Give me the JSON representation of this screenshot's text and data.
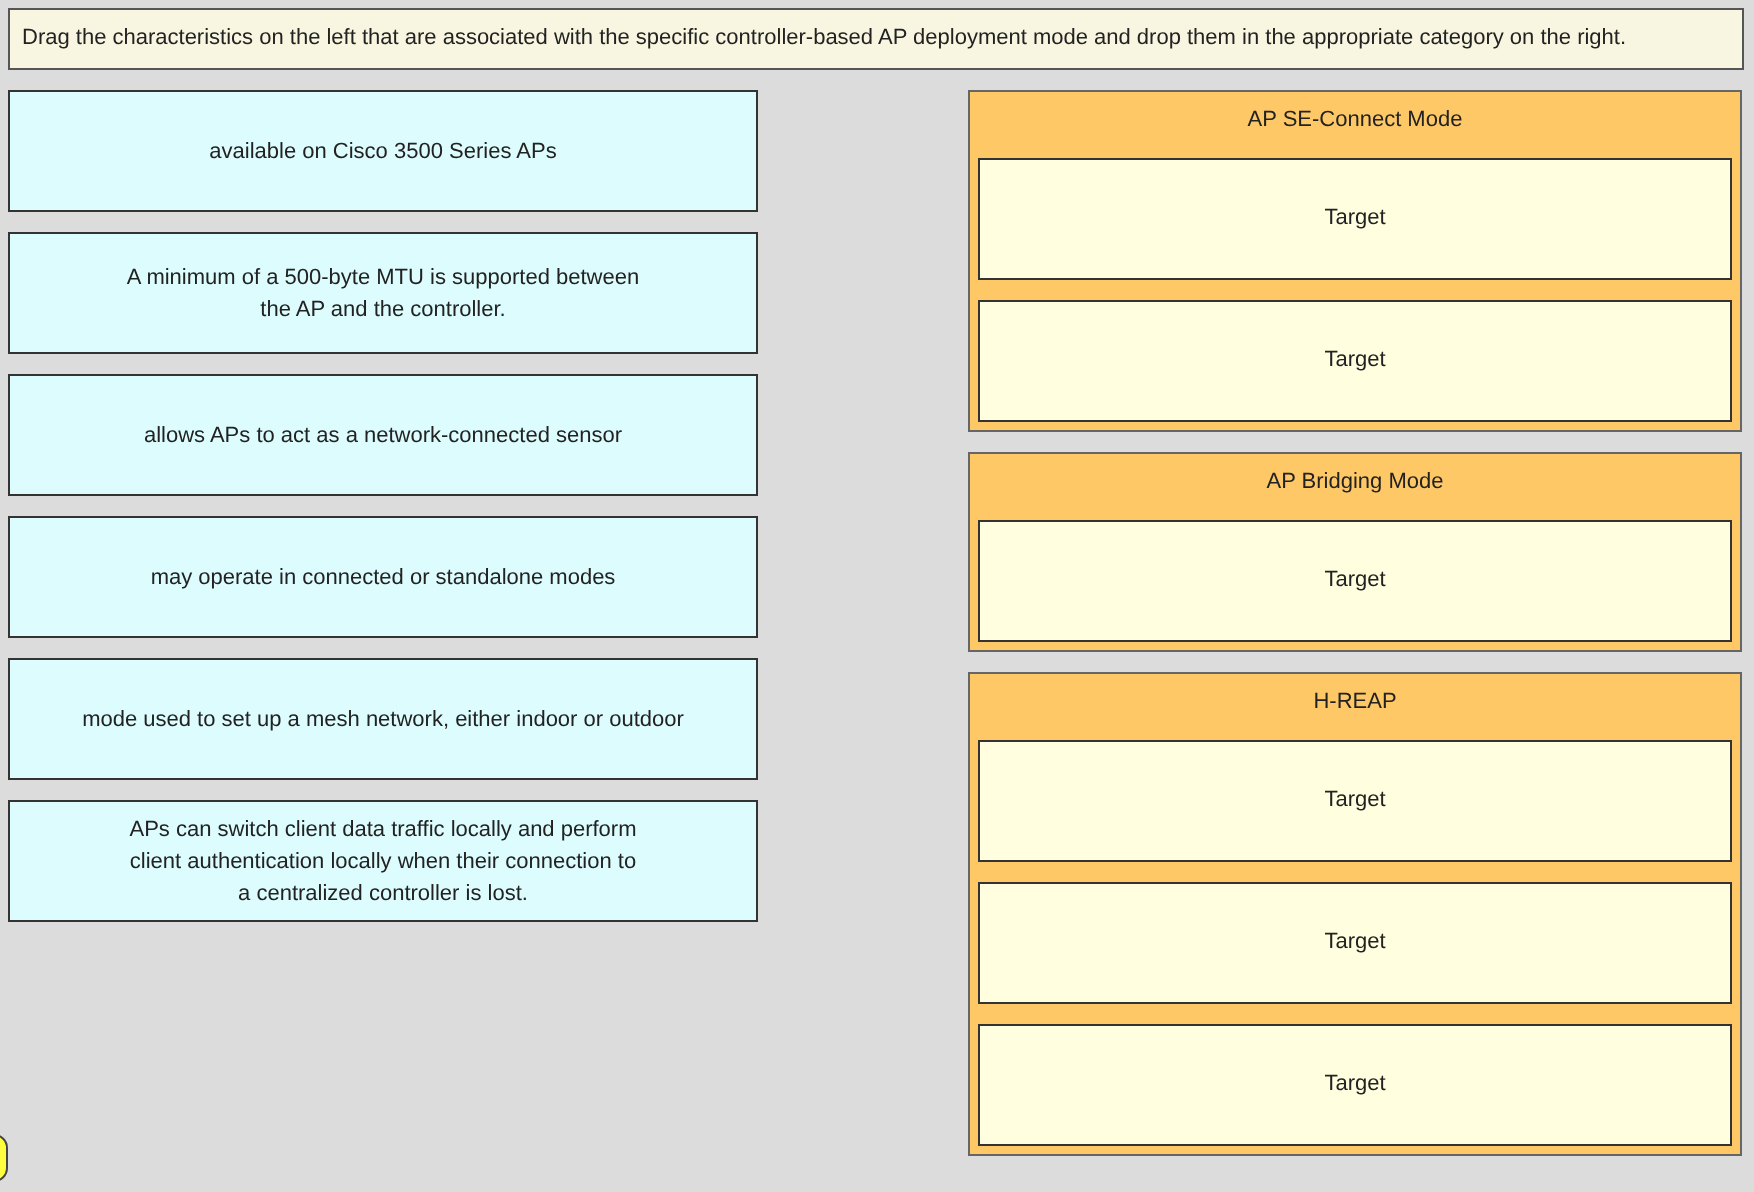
{
  "instructions": "Drag the characteristics on the left that are associated with the specific controller-based AP deployment mode and drop them in the appropriate category on the right.",
  "items": [
    {
      "lines": [
        "available on Cisco 3500 Series APs"
      ]
    },
    {
      "lines": [
        "A minimum of a 500-byte MTU is supported between",
        "the AP and the controller."
      ]
    },
    {
      "lines": [
        "allows APs to act as a network-connected sensor"
      ]
    },
    {
      "lines": [
        "may operate in connected or standalone modes"
      ]
    },
    {
      "lines": [
        "mode used to set up a mesh network, either indoor or outdoor"
      ]
    },
    {
      "lines": [
        "APs can switch client data traffic locally and perform",
        "client authentication locally when their connection to",
        "a centralized controller is lost."
      ]
    }
  ],
  "categories": [
    {
      "title": "AP SE-Connect Mode",
      "targets": [
        "Target",
        "Target"
      ]
    },
    {
      "title": "AP Bridging Mode",
      "targets": [
        "Target"
      ]
    },
    {
      "title": "H-REAP",
      "targets": [
        "Target",
        "Target",
        "Target"
      ]
    }
  ]
}
